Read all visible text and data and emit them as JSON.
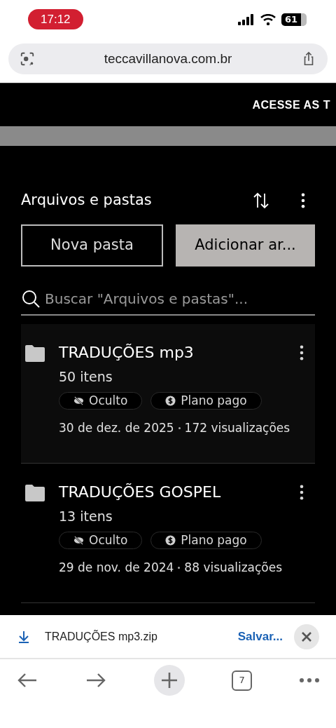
{
  "status_bar": {
    "time": "17:12",
    "battery": "61"
  },
  "address_bar": {
    "url": "teccavillanova.com.br"
  },
  "banner": {
    "text": "ACESSE AS T"
  },
  "section": {
    "title": "Arquivos e pastas"
  },
  "buttons": [
    {
      "label": "Nova pasta",
      "kind": "outline"
    },
    {
      "label": "Adicionar ar...",
      "kind": "filled"
    }
  ],
  "search": {
    "placeholder": "Buscar \"Arquivos e pastas\"..."
  },
  "folders": [
    {
      "name": "TRADUÇÕES mp3",
      "count": "50 itens",
      "tags": [
        {
          "label": "Oculto",
          "kind": "hidden"
        },
        {
          "label": "Plano pago",
          "kind": "paid"
        }
      ],
      "date": "30 de dez. de 2025",
      "views": "172 visualizações",
      "selected": true
    },
    {
      "name": "TRADUÇÕES GOSPEL",
      "count": "13 itens",
      "tags": [
        {
          "label": "Oculto",
          "kind": "hidden"
        },
        {
          "label": "Plano pago",
          "kind": "paid"
        }
      ],
      "date": "29 de nov. de 2024",
      "views": "88 visualizações",
      "selected": false
    }
  ],
  "download_bar": {
    "file": "TRADUÇÕES mp3.zip",
    "action": "Salvar..."
  },
  "toolbar": {
    "tabs_count": "7"
  }
}
